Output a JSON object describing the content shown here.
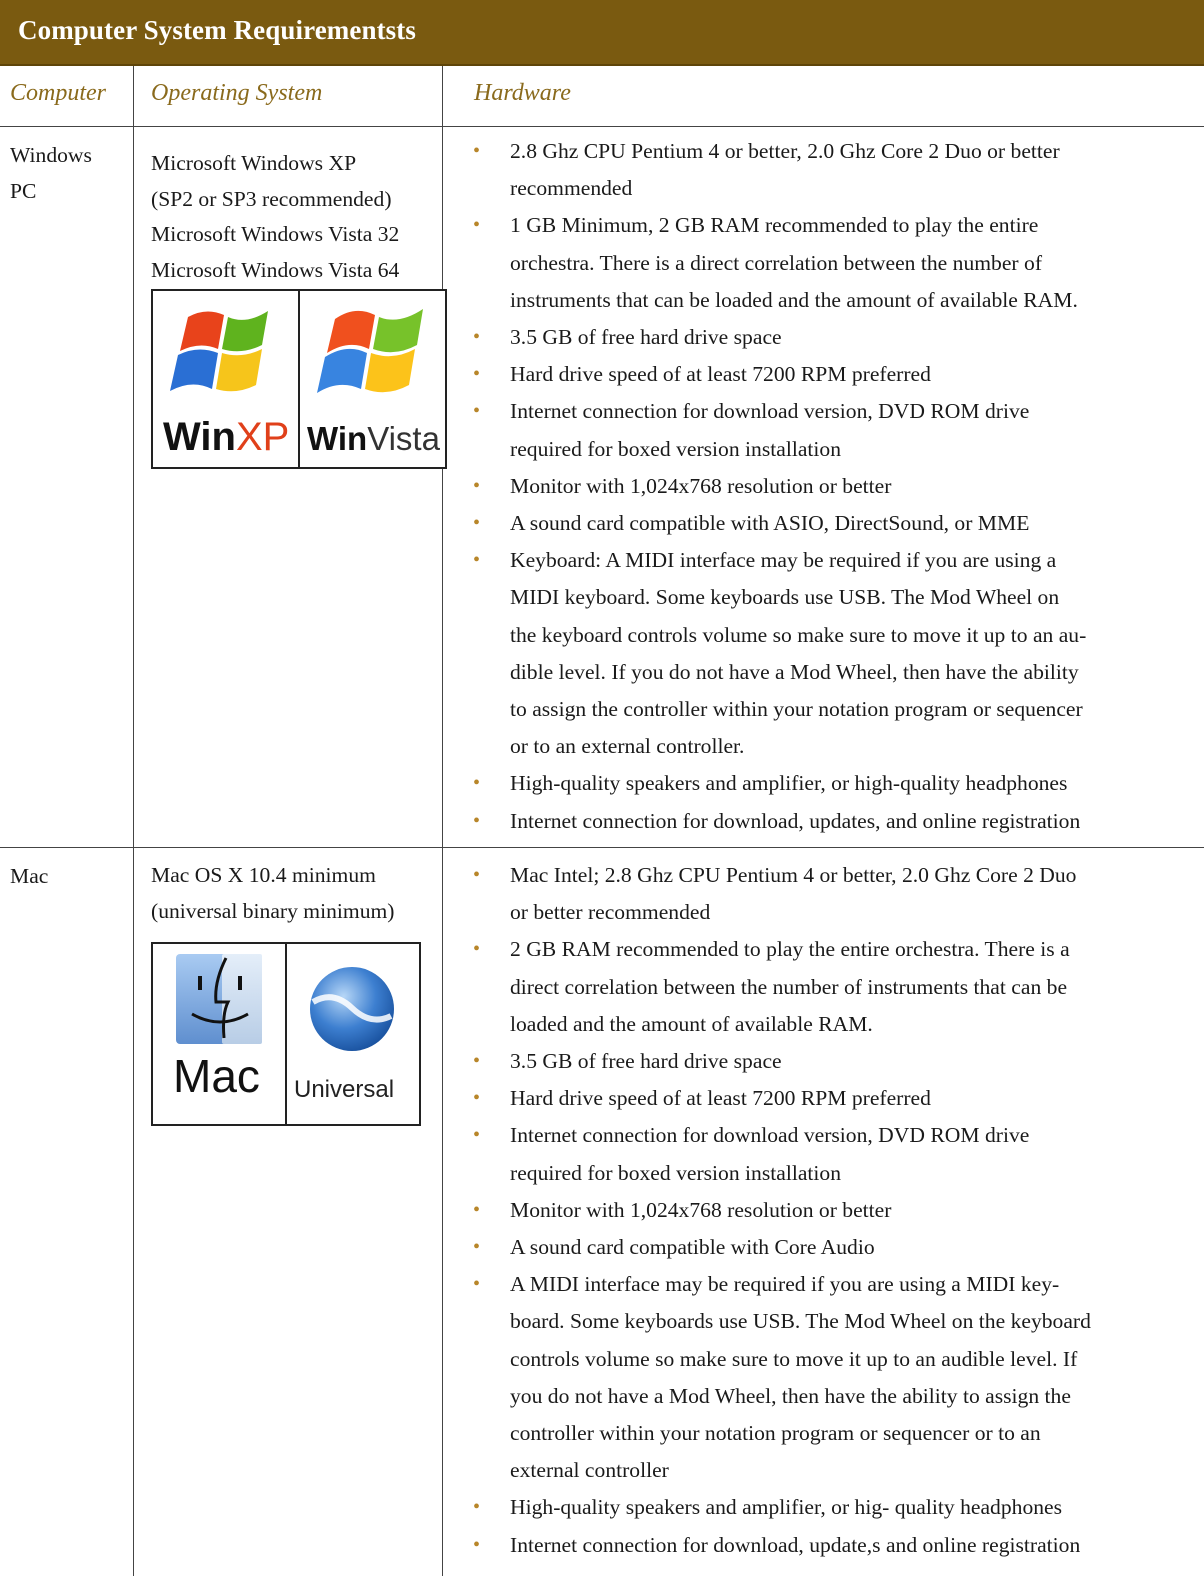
{
  "title": "Computer System Requirementsts",
  "headers": {
    "computer": "Computer",
    "os": "Operating System",
    "hardware": "Hardware"
  },
  "rows": [
    {
      "computer_lines": [
        "Windows",
        "PC"
      ],
      "os_lines": [
        "Microsoft Windows XP",
        "(SP2 or SP3 recommended)",
        "Microsoft Windows Vista 32",
        "Microsoft Windows Vista 64"
      ],
      "logos": {
        "left_bold": "Win",
        "left_light": "XP",
        "right_bold": "Win",
        "right_light": "Vista"
      },
      "hardware": [
        [
          "2.8 Ghz CPU Pentium 4 or better, 2.0 Ghz Core 2 Duo or better",
          "recommended"
        ],
        [
          "1 GB Minimum, 2 GB RAM recommended to play the entire",
          "orchestra. There is a direct correlation between the number of",
          "instruments that can be loaded and the amount of available RAM."
        ],
        [
          "3.5 GB of free hard drive space"
        ],
        [
          "Hard drive speed of at least 7200 RPM preferred"
        ],
        [
          "Internet connection for download version, DVD ROM drive",
          "required for boxed version installation"
        ],
        [
          "Monitor with 1,024x768 resolution or better"
        ],
        [
          "A sound card compatible with ASIO, DirectSound, or MME"
        ],
        [
          "Keyboard: A MIDI interface may be required if you are using a",
          "MIDI keyboard. Some keyboards use USB.  The Mod Wheel on",
          "the keyboard controls volume so make sure to move it up to an au-",
          "dible level.  If you do not have a Mod Wheel, then have the ability",
          "to assign the controller within your notation program or sequencer",
          "or to an external controller."
        ],
        [
          "High-quality speakers and amplifier, or high-quality headphones"
        ],
        [
          "Internet connection for download, updates, and online registration"
        ]
      ]
    },
    {
      "computer_lines": [
        "Mac"
      ],
      "os_lines": [
        "Mac OS X 10.4 minimum",
        "(universal binary minimum)"
      ],
      "logos": {
        "left": "Mac",
        "right": "Universal"
      },
      "hardware": [
        [
          "Mac Intel; 2.8 Ghz CPU Pentium 4 or better, 2.0 Ghz Core 2 Duo",
          "or better recommended"
        ],
        [
          "2 GB RAM recommended to play the entire orchestra. There is a",
          "direct correlation between the number of instruments that can be",
          "loaded and the amount of available RAM."
        ],
        [
          "3.5 GB of free hard drive space"
        ],
        [
          "Hard drive speed of at least 7200 RPM preferred"
        ],
        [
          "Internet connection for download version, DVD ROM drive",
          "required for boxed version installation"
        ],
        [
          "Monitor with 1,024x768 resolution or better"
        ],
        [
          "A sound card compatible with Core Audio"
        ],
        [
          "A MIDI interface may be required if you are using a MIDI key-",
          "board. Some keyboards use USB. The Mod Wheel on the keyboard",
          "controls volume so make sure to move it up to an audible level.  If",
          "you do not have a Mod Wheel, then have the ability to assign the",
          "controller within your notation program or sequencer or to an",
          "external controller"
        ],
        [
          "High-quality speakers and amplifier, or hig- quality headphones"
        ],
        [
          "Internet connection for download, update,s and online registration"
        ]
      ]
    }
  ]
}
